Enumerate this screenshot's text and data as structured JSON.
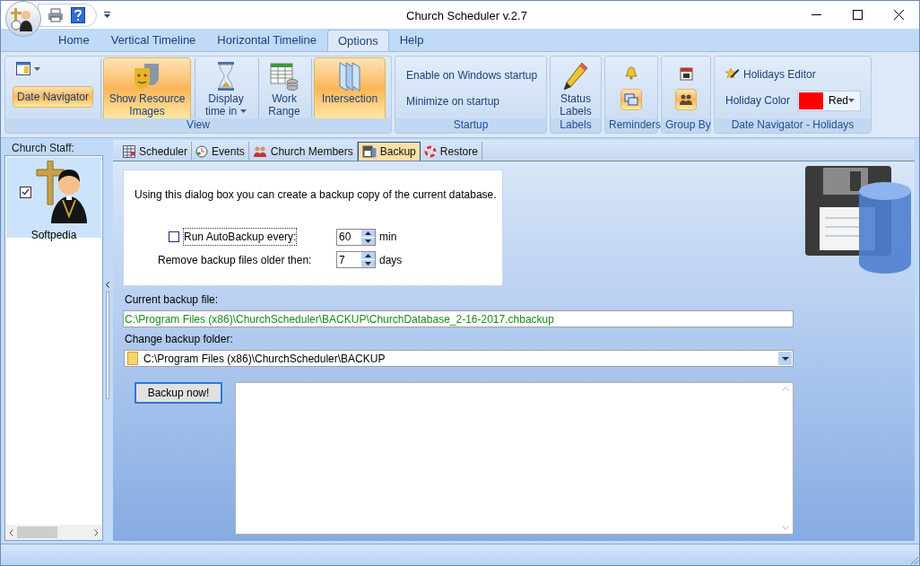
{
  "window": {
    "title": "Church Scheduler v.2.7"
  },
  "ribbon_tabs": [
    {
      "label": "Home",
      "selected": false
    },
    {
      "label": "Vertical Timeline",
      "selected": false
    },
    {
      "label": "Horizontal Timeline",
      "selected": false
    },
    {
      "label": "Options",
      "selected": true
    },
    {
      "label": "Help",
      "selected": false
    }
  ],
  "ribbon_groups": [
    {
      "title": "View",
      "items": [
        {
          "kind": "small",
          "label": "Date Navigator",
          "selected": true
        },
        {
          "kind": "large",
          "label": "Show Resource Images",
          "selected": true
        },
        {
          "kind": "large",
          "label": "Display time in",
          "selected": false,
          "dropdown": true
        },
        {
          "kind": "large",
          "label": "Work Range",
          "selected": false
        },
        {
          "kind": "large",
          "label": "Intersection",
          "selected": true
        }
      ]
    },
    {
      "title": "Startup",
      "items": [
        {
          "kind": "link",
          "label": "Enable on Windows startup"
        },
        {
          "kind": "link",
          "label": "Minimize on startup"
        }
      ]
    },
    {
      "title": "Labels",
      "items": [
        {
          "kind": "large",
          "label": "Status Labels",
          "selected": false
        }
      ]
    },
    {
      "title": "Reminders",
      "items": [
        {
          "kind": "icon",
          "selected": true
        }
      ]
    },
    {
      "title": "Group By",
      "items": [
        {
          "kind": "icon",
          "selected": true
        }
      ]
    },
    {
      "title": "Date Navigator - Holidays",
      "items": [
        {
          "kind": "link",
          "label": "Holidays Editor"
        },
        {
          "kind": "color",
          "label": "Holiday Color",
          "value": "Red",
          "color": "#ff0000"
        }
      ]
    }
  ],
  "staff_panel": {
    "title": "Church Staff:",
    "items": [
      {
        "name": "Softpedia",
        "checked": true,
        "selected": true
      }
    ]
  },
  "content_tabs": [
    {
      "label": "Scheduler",
      "selected": false
    },
    {
      "label": "Events",
      "selected": false
    },
    {
      "label": "Church Members",
      "selected": false
    },
    {
      "label": "Backup",
      "selected": true
    },
    {
      "label": "Restore",
      "selected": false
    }
  ],
  "backup": {
    "intro": "Using this dialog box you can create a backup copy of the current database.",
    "autobackup": {
      "label": "Run AutoBackup every:",
      "checked": false,
      "value": "60",
      "unit": "min"
    },
    "remove": {
      "label": "Remove backup files older then:",
      "value": "7",
      "unit": "days"
    },
    "current_file": {
      "label": "Current backup file:",
      "value": "C:\\Program Files (x86)\\ChurchScheduler\\BACKUP\\ChurchDatabase_2-16-2017.chbackup"
    },
    "folder": {
      "label": "Change backup folder:",
      "value": "C:\\Program Files (x86)\\ChurchScheduler\\BACKUP"
    },
    "button": "Backup now!"
  }
}
